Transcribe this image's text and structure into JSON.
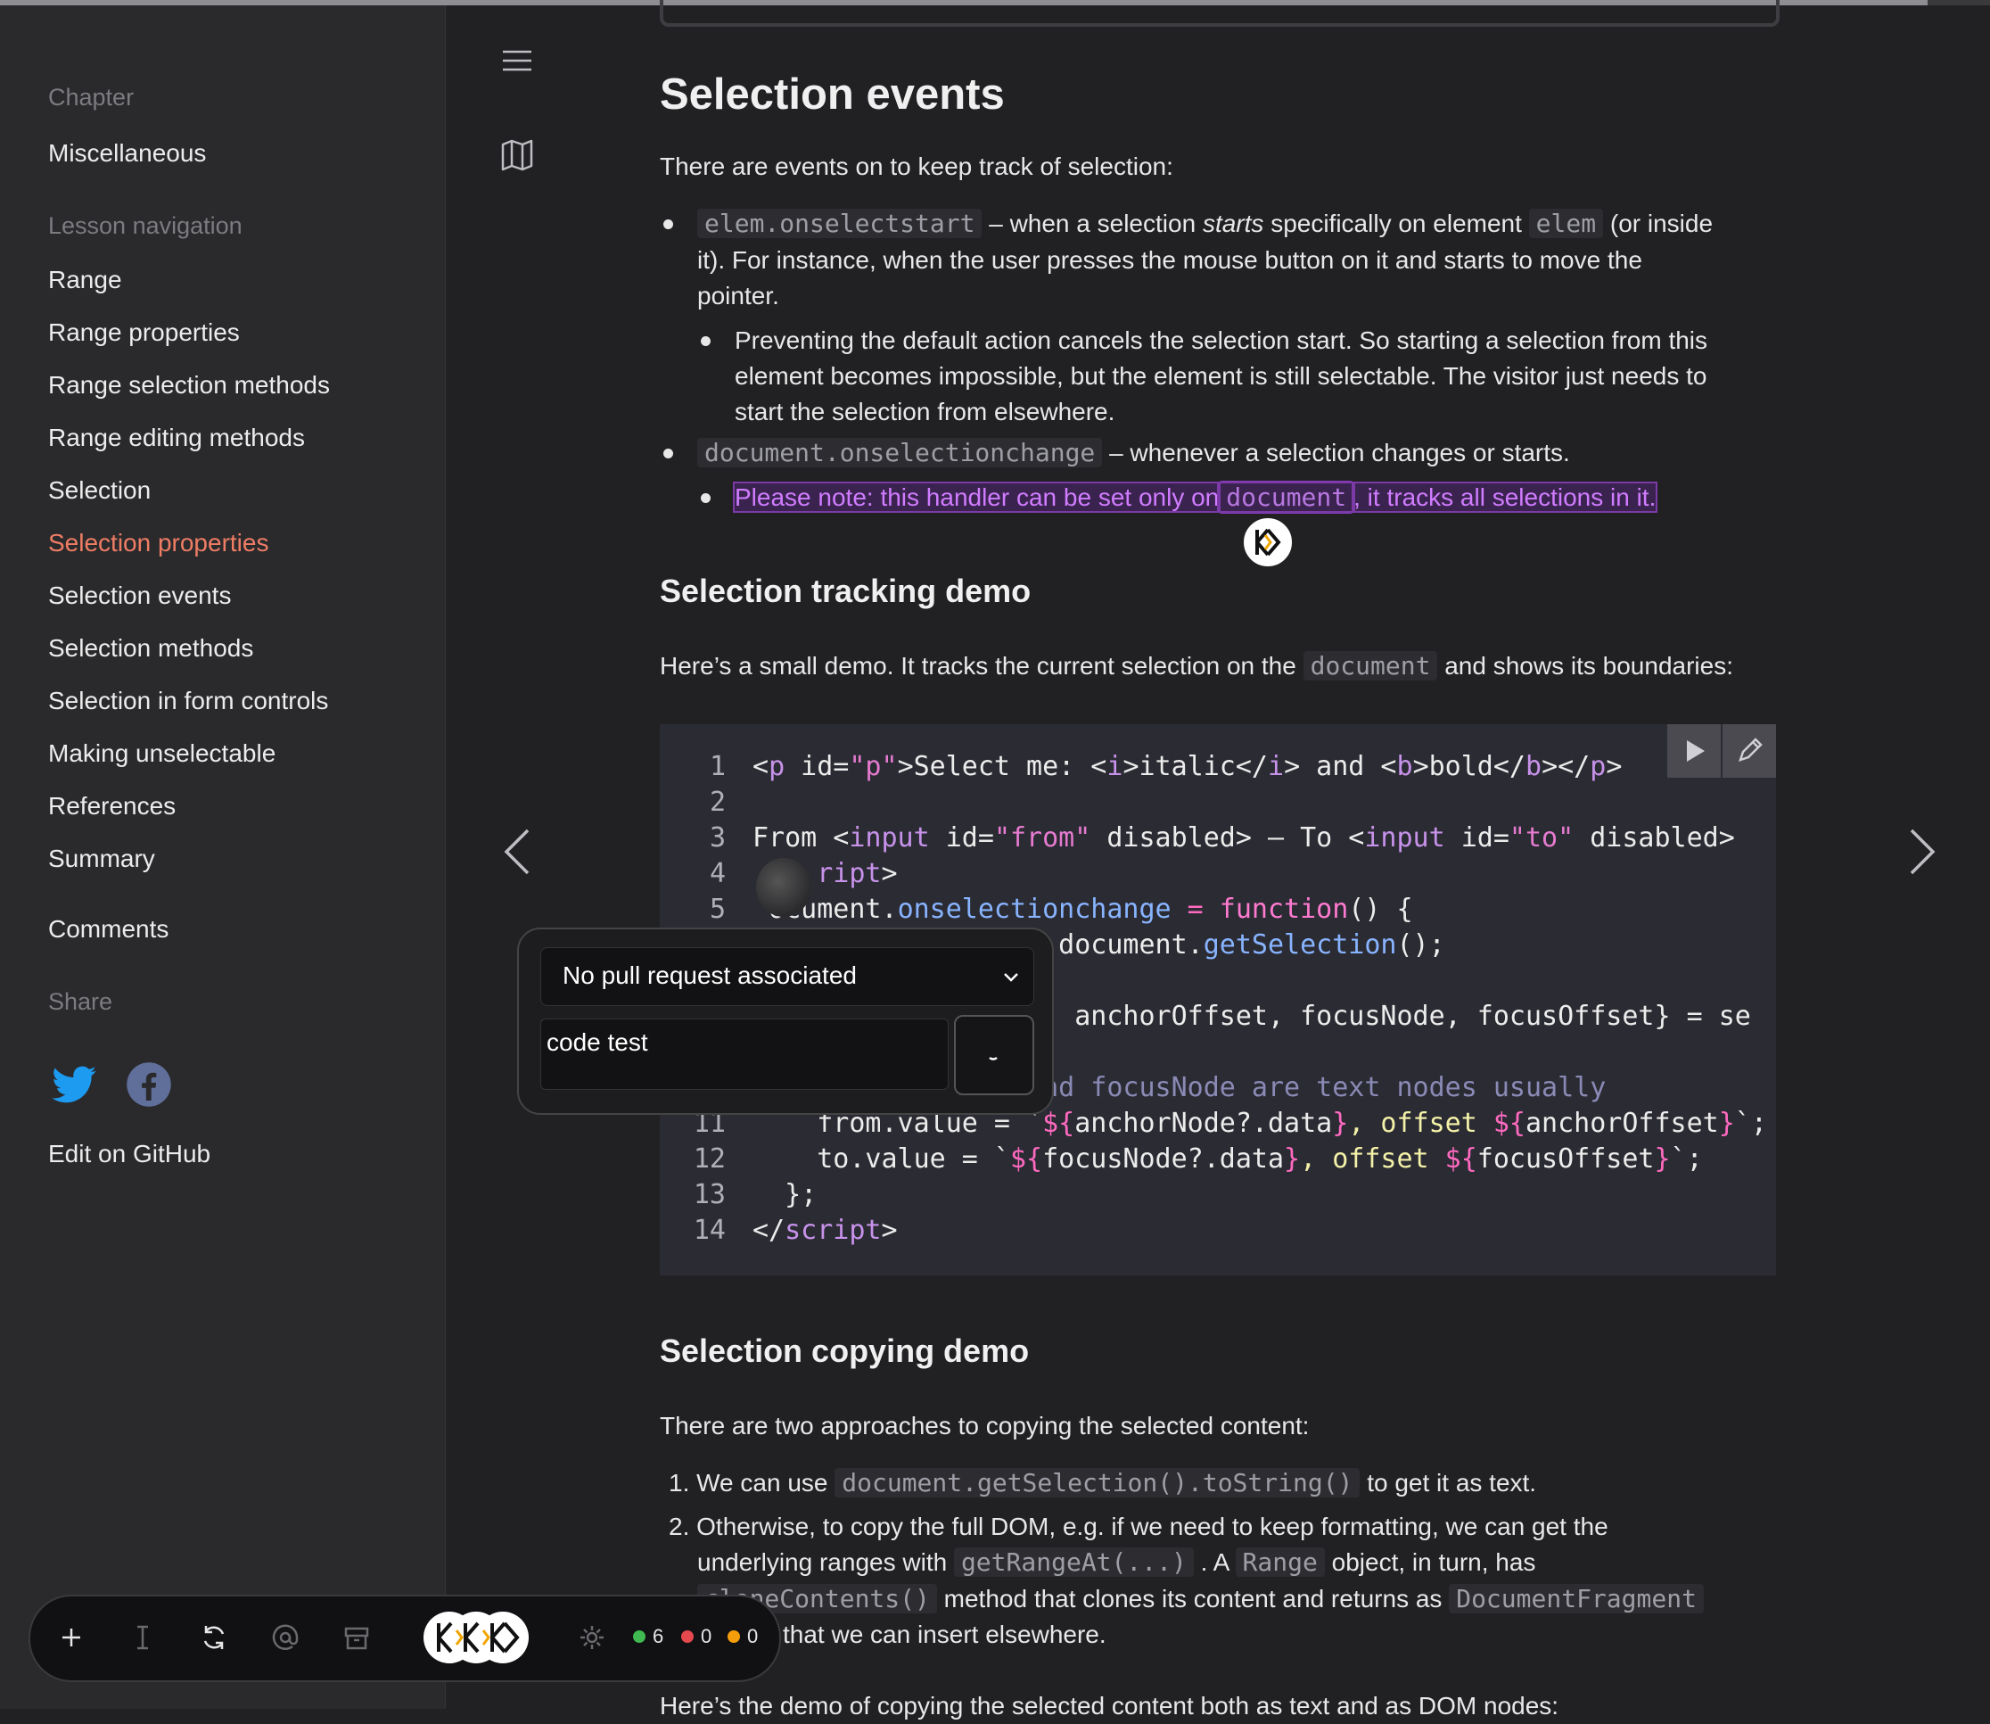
{
  "sidebar": {
    "chapter_label": "Chapter",
    "chapter": "Miscellaneous",
    "lesson_nav_label": "Lesson navigation",
    "items": [
      {
        "label": "Range"
      },
      {
        "label": "Range properties"
      },
      {
        "label": "Range selection methods"
      },
      {
        "label": "Range editing methods"
      },
      {
        "label": "Selection"
      },
      {
        "label": "Selection properties"
      },
      {
        "label": "Selection events"
      },
      {
        "label": "Selection methods"
      },
      {
        "label": "Selection in form controls"
      },
      {
        "label": "Making unselectable"
      },
      {
        "label": "References"
      },
      {
        "label": "Summary"
      }
    ],
    "active_item": "Selection properties",
    "comments": "Comments",
    "share_label": "Share",
    "edit": "Edit on GitHub"
  },
  "content": {
    "h_events": "Selection events",
    "p_events": "There are events on to keep track of selection:",
    "b1_code": "elem.onselectstart",
    "b1_t1": "– when a selection",
    "b1_em": "starts",
    "b1_t2": "specifically on element",
    "b1_code2": "elem",
    "b1_t3": "(or inside",
    "b1_line2": "it). For instance, when the user presses the mouse button on it and starts to move the",
    "b1_line3": "pointer.",
    "b1a_line1": "Preventing the default action cancels the selection start. So starting a selection from this",
    "b1a_line2": "element becomes impossible, but the element is still selectable. The visitor just needs to",
    "b1a_line3": "start the selection from elsewhere.",
    "b2_code": "document.onselectionchange",
    "b2_text": "– whenever a selection changes or starts.",
    "b2a_t1": "Please note: this handler can be set only on",
    "b2a_code": "document",
    "b2a_t2": ", it tracks all selections in it.",
    "h_tracking": "Selection tracking demo",
    "p_tracking_1": "Here’s a small demo. It tracks the current selection on the",
    "p_tracking_code": "document",
    "p_tracking_2": "and shows its boundaries:",
    "h_copying": "Selection copying demo",
    "p_copying": "There are two approaches to copying the selected content:",
    "ol1_t1": "1. We can use",
    "ol1_code": "document.getSelection().toString()",
    "ol1_t2": "to get it as text.",
    "ol2_line1": "2. Otherwise, to copy the full DOM, e.g. if we need to keep formatting, we can get the",
    "ol2_t1": "underlying ranges with",
    "ol2_code1": "getRangeAt(...)",
    "ol2_t2": ". A",
    "ol2_code2": "Range",
    "ol2_t3": "object, in turn, has",
    "ol2_code3": "cloneContents()",
    "ol2_t4": "method that clones its content and returns as",
    "ol2_code4": "DocumentFragment",
    "ol2_t5": "that we can insert elsewhere.",
    "p_last": "Here’s the demo of copying the selected content both as text and as DOM nodes:"
  },
  "code": {
    "l1_num": "1",
    "l2_num": "2",
    "l3_num": "3",
    "l4_num": "4",
    "l5_num": "5",
    "l11_num": "11",
    "l12_num": "12",
    "l13_num": "13",
    "l14_num": "14",
    "l1": [
      "<",
      "p",
      " id=",
      "\"p\"",
      ">Select me: <",
      "i",
      ">italic</",
      "i",
      "> and <",
      "b",
      ">bold</",
      "b",
      "></",
      "p",
      ">"
    ],
    "l3": [
      "From <",
      "input",
      " id=",
      "\"from\"",
      " disabled> – To <",
      "input",
      " id=",
      "\"to\"",
      " disabled>"
    ],
    "l4": [
      "ript",
      ">"
    ],
    "l5": [
      "ocument.",
      "onselectionchange",
      " = ",
      "function",
      "() {"
    ],
    "l6": [
      "= document.",
      "getSelection",
      "();"
    ],
    "l8": [
      "e, anchorOffset, focusNode, focusOffset} = se"
    ],
    "l10": [
      "and focusNode are text nodes usually"
    ],
    "l11": [
      "    from.value = `",
      "${",
      "anchorNode?.",
      "data",
      "}",
      ", offset ",
      "${",
      "anchorOffset",
      "}",
      "`;"
    ],
    "l12": [
      "    to.value = `",
      "${",
      "focusNode?.",
      "data",
      "}",
      ", offset ",
      "${",
      "focusOffset",
      "}",
      "`;"
    ],
    "l13": [
      "  };"
    ],
    "l14": [
      "</",
      "script",
      ">"
    ]
  },
  "popup": {
    "select_value": "No pull request associated",
    "textarea_value": "code test"
  },
  "toolbar": {
    "green_count": "6",
    "red_count": "0",
    "orange_count": "0"
  },
  "colors": {
    "accent": "#ef7d64",
    "highlight": "#d07cff",
    "green": "#3fb950",
    "red": "#e5484d",
    "orange": "#f59e0b"
  }
}
